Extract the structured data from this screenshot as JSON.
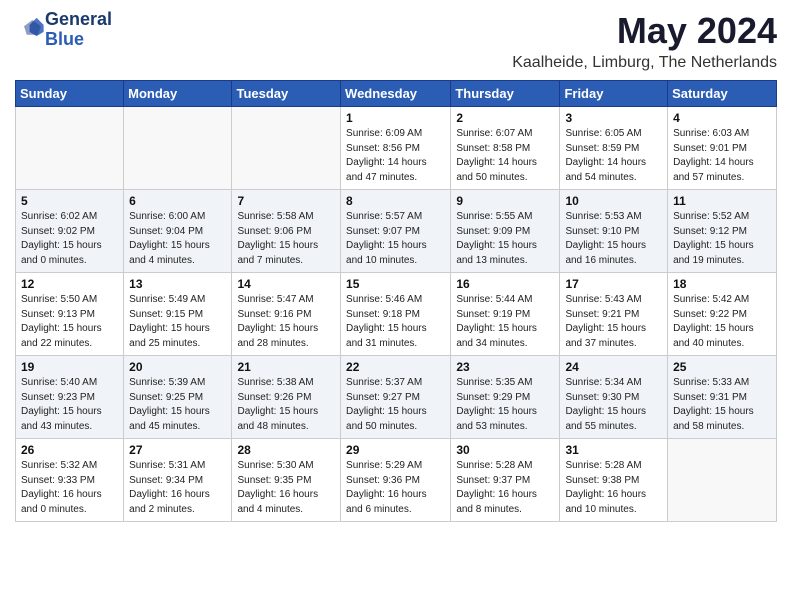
{
  "logo": {
    "text_general": "General",
    "text_blue": "Blue"
  },
  "header": {
    "month_year": "May 2024",
    "location": "Kaalheide, Limburg, The Netherlands"
  },
  "weekdays": [
    "Sunday",
    "Monday",
    "Tuesday",
    "Wednesday",
    "Thursday",
    "Friday",
    "Saturday"
  ],
  "weeks": [
    [
      {
        "day": "",
        "info": ""
      },
      {
        "day": "",
        "info": ""
      },
      {
        "day": "",
        "info": ""
      },
      {
        "day": "1",
        "info": "Sunrise: 6:09 AM\nSunset: 8:56 PM\nDaylight: 14 hours\nand 47 minutes."
      },
      {
        "day": "2",
        "info": "Sunrise: 6:07 AM\nSunset: 8:58 PM\nDaylight: 14 hours\nand 50 minutes."
      },
      {
        "day": "3",
        "info": "Sunrise: 6:05 AM\nSunset: 8:59 PM\nDaylight: 14 hours\nand 54 minutes."
      },
      {
        "day": "4",
        "info": "Sunrise: 6:03 AM\nSunset: 9:01 PM\nDaylight: 14 hours\nand 57 minutes."
      }
    ],
    [
      {
        "day": "5",
        "info": "Sunrise: 6:02 AM\nSunset: 9:02 PM\nDaylight: 15 hours\nand 0 minutes."
      },
      {
        "day": "6",
        "info": "Sunrise: 6:00 AM\nSunset: 9:04 PM\nDaylight: 15 hours\nand 4 minutes."
      },
      {
        "day": "7",
        "info": "Sunrise: 5:58 AM\nSunset: 9:06 PM\nDaylight: 15 hours\nand 7 minutes."
      },
      {
        "day": "8",
        "info": "Sunrise: 5:57 AM\nSunset: 9:07 PM\nDaylight: 15 hours\nand 10 minutes."
      },
      {
        "day": "9",
        "info": "Sunrise: 5:55 AM\nSunset: 9:09 PM\nDaylight: 15 hours\nand 13 minutes."
      },
      {
        "day": "10",
        "info": "Sunrise: 5:53 AM\nSunset: 9:10 PM\nDaylight: 15 hours\nand 16 minutes."
      },
      {
        "day": "11",
        "info": "Sunrise: 5:52 AM\nSunset: 9:12 PM\nDaylight: 15 hours\nand 19 minutes."
      }
    ],
    [
      {
        "day": "12",
        "info": "Sunrise: 5:50 AM\nSunset: 9:13 PM\nDaylight: 15 hours\nand 22 minutes."
      },
      {
        "day": "13",
        "info": "Sunrise: 5:49 AM\nSunset: 9:15 PM\nDaylight: 15 hours\nand 25 minutes."
      },
      {
        "day": "14",
        "info": "Sunrise: 5:47 AM\nSunset: 9:16 PM\nDaylight: 15 hours\nand 28 minutes."
      },
      {
        "day": "15",
        "info": "Sunrise: 5:46 AM\nSunset: 9:18 PM\nDaylight: 15 hours\nand 31 minutes."
      },
      {
        "day": "16",
        "info": "Sunrise: 5:44 AM\nSunset: 9:19 PM\nDaylight: 15 hours\nand 34 minutes."
      },
      {
        "day": "17",
        "info": "Sunrise: 5:43 AM\nSunset: 9:21 PM\nDaylight: 15 hours\nand 37 minutes."
      },
      {
        "day": "18",
        "info": "Sunrise: 5:42 AM\nSunset: 9:22 PM\nDaylight: 15 hours\nand 40 minutes."
      }
    ],
    [
      {
        "day": "19",
        "info": "Sunrise: 5:40 AM\nSunset: 9:23 PM\nDaylight: 15 hours\nand 43 minutes."
      },
      {
        "day": "20",
        "info": "Sunrise: 5:39 AM\nSunset: 9:25 PM\nDaylight: 15 hours\nand 45 minutes."
      },
      {
        "day": "21",
        "info": "Sunrise: 5:38 AM\nSunset: 9:26 PM\nDaylight: 15 hours\nand 48 minutes."
      },
      {
        "day": "22",
        "info": "Sunrise: 5:37 AM\nSunset: 9:27 PM\nDaylight: 15 hours\nand 50 minutes."
      },
      {
        "day": "23",
        "info": "Sunrise: 5:35 AM\nSunset: 9:29 PM\nDaylight: 15 hours\nand 53 minutes."
      },
      {
        "day": "24",
        "info": "Sunrise: 5:34 AM\nSunset: 9:30 PM\nDaylight: 15 hours\nand 55 minutes."
      },
      {
        "day": "25",
        "info": "Sunrise: 5:33 AM\nSunset: 9:31 PM\nDaylight: 15 hours\nand 58 minutes."
      }
    ],
    [
      {
        "day": "26",
        "info": "Sunrise: 5:32 AM\nSunset: 9:33 PM\nDaylight: 16 hours\nand 0 minutes."
      },
      {
        "day": "27",
        "info": "Sunrise: 5:31 AM\nSunset: 9:34 PM\nDaylight: 16 hours\nand 2 minutes."
      },
      {
        "day": "28",
        "info": "Sunrise: 5:30 AM\nSunset: 9:35 PM\nDaylight: 16 hours\nand 4 minutes."
      },
      {
        "day": "29",
        "info": "Sunrise: 5:29 AM\nSunset: 9:36 PM\nDaylight: 16 hours\nand 6 minutes."
      },
      {
        "day": "30",
        "info": "Sunrise: 5:28 AM\nSunset: 9:37 PM\nDaylight: 16 hours\nand 8 minutes."
      },
      {
        "day": "31",
        "info": "Sunrise: 5:28 AM\nSunset: 9:38 PM\nDaylight: 16 hours\nand 10 minutes."
      },
      {
        "day": "",
        "info": ""
      }
    ]
  ]
}
